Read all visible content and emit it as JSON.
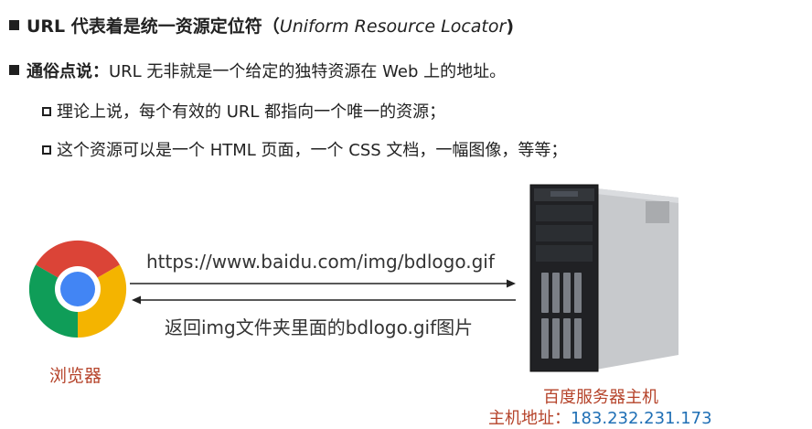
{
  "heading": {
    "text_main": "URL 代表着是统一资源定位符（",
    "text_italic": "Uniform Resource Locator",
    "text_end": ")"
  },
  "bullet1": {
    "label": "通俗点说",
    "colon": "：",
    "text": "URL 无非就是一个给定的独特资源在 Web 上的地址。"
  },
  "sub_items": [
    "理论上说，每个有效的 URL 都指向一个唯一的资源；",
    "这个资源可以是一个 HTML 页面，一个 CSS 文档，一幅图像，等等；"
  ],
  "diagram": {
    "request_text": "https://www.baidu.com/img/bdlogo.gif",
    "response_text": "返回img文件夹里面的bdlogo.gif图片",
    "browser_label": "浏览器",
    "server_label": "百度服务器主机",
    "server_address_label": "主机地址：",
    "server_ip": "183.232.231.173"
  },
  "colors": {
    "label_red": "#b5432a",
    "ip_blue": "#1f6fb5"
  },
  "icons": {
    "browser": "chrome-logo-icon",
    "server": "tower-server-icon"
  }
}
